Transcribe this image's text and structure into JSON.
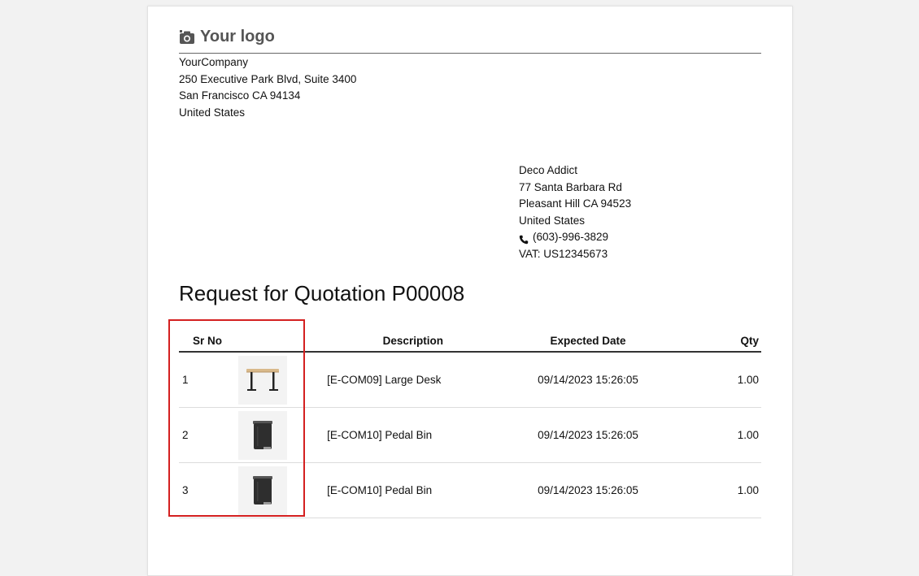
{
  "logo": {
    "text": "Your logo",
    "icon": "camera-icon"
  },
  "company": {
    "name": "YourCompany",
    "street": "250 Executive Park Blvd, Suite 3400",
    "city_line": "San Francisco CA 94134",
    "country": "United States"
  },
  "partner": {
    "name": "Deco Addict",
    "street": "77 Santa Barbara Rd",
    "city_line": "Pleasant Hill CA 94523",
    "country": "United States",
    "phone": "(603)-996-3829",
    "vat": "VAT: US12345673",
    "phone_icon": "phone-icon"
  },
  "title": "Request for Quotation P00008",
  "table": {
    "headers": {
      "sr_no": "Sr No",
      "description": "Description",
      "expected_date": "Expected Date",
      "qty": "Qty"
    },
    "rows": [
      {
        "sr": "1",
        "image": "desk-image",
        "description": "[E-COM09] Large Desk",
        "date": "09/14/2023 15:26:05",
        "qty": "1.00"
      },
      {
        "sr": "2",
        "image": "pedal-bin-image",
        "description": "[E-COM10] Pedal Bin",
        "date": "09/14/2023 15:26:05",
        "qty": "1.00"
      },
      {
        "sr": "3",
        "image": "pedal-bin-image",
        "description": "[E-COM10] Pedal Bin",
        "date": "09/14/2023 15:26:05",
        "qty": "1.00"
      }
    ]
  },
  "colors": {
    "highlight": "#d42020",
    "page_bg": "#ffffff",
    "canvas_bg": "#f2f2f2"
  }
}
